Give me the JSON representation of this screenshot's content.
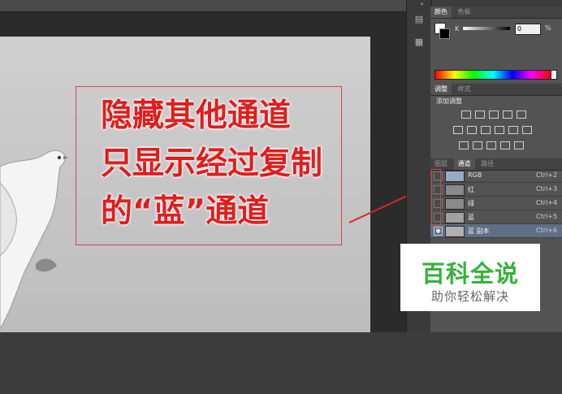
{
  "annotation": {
    "lines": [
      "隐藏其他通道",
      "只显示经过复制",
      "的“蓝”通道"
    ]
  },
  "color_panel": {
    "tabs": [
      "颜色",
      "色板"
    ],
    "channel_label": "K",
    "value": "0",
    "unit": "%"
  },
  "adjust_panel": {
    "tabs": [
      "调整",
      "样式"
    ],
    "title": "添加调整"
  },
  "channels_panel": {
    "tabs": [
      "图层",
      "通道",
      "路径"
    ],
    "rows": [
      {
        "name": "RGB",
        "shortcut": "Ctrl+2"
      },
      {
        "name": "红",
        "shortcut": "Ctrl+3"
      },
      {
        "name": "绿",
        "shortcut": "Ctrl+4"
      },
      {
        "name": "蓝",
        "shortcut": "Ctrl+5"
      },
      {
        "name": "蓝 副本",
        "shortcut": "Ctrl+6"
      }
    ]
  },
  "watermark": {
    "title": "百科全说",
    "subtitle": "助你轻松解决"
  }
}
